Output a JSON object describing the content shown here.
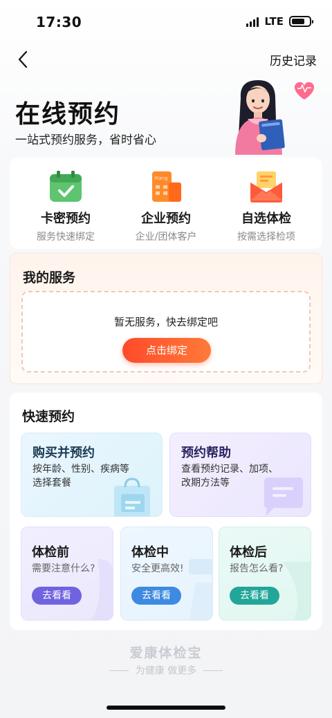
{
  "status_bar": {
    "time": "17:30",
    "network": "LTE"
  },
  "nav": {
    "history_label": "历史记录"
  },
  "hero": {
    "title": "在线预约",
    "subtitle": "一站式预约服务，省时省心"
  },
  "entries": [
    {
      "title": "卡密预约",
      "desc": "服务快速绑定",
      "icon": "calendar-check-icon"
    },
    {
      "title": "企业预约",
      "desc": "企业/团体客户",
      "icon": "building-icon",
      "icon_text": "iKang"
    },
    {
      "title": "自选体检",
      "desc": "按需选择检项",
      "icon": "envelope-icon"
    }
  ],
  "my_service": {
    "title": "我的服务",
    "empty_text": "暂无服务，快去绑定吧",
    "bind_button": "点击绑定"
  },
  "quick_booking": {
    "title": "快速预约",
    "buy": {
      "title": "购买并预约",
      "desc_line1": "按年龄、性别、疾病等",
      "desc_line2": "选择套餐"
    },
    "help": {
      "title": "预约帮助",
      "desc_line1": "查看预约记录、加项、",
      "desc_line2": "改期方法等"
    },
    "before": {
      "title": "体检前",
      "desc": "需要注意什么?",
      "button": "去看看"
    },
    "during": {
      "title": "体检中",
      "desc": "安全更高效!",
      "button": "去看看"
    },
    "after": {
      "title": "体检后",
      "desc": "报告怎么看?",
      "button": "去看看"
    }
  },
  "footer": {
    "brand": "爱康体检宝",
    "slogan": "为健康 做更多"
  },
  "colors": {
    "accent_orange": "#ff4a2a",
    "before_button": "#6f63e0",
    "during_button": "#3d8ae0",
    "after_button": "#22a69a"
  }
}
